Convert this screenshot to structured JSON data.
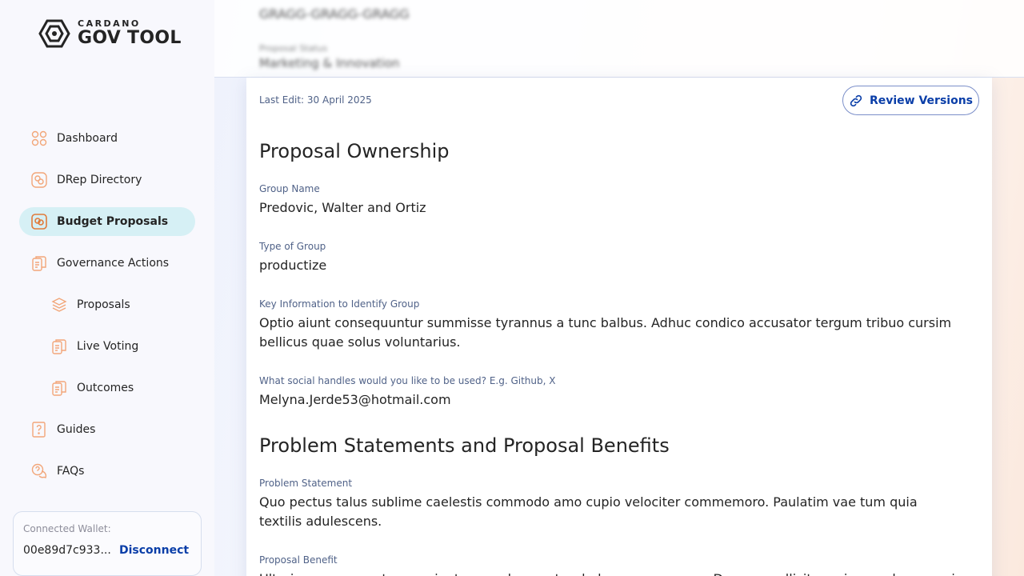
{
  "brand": {
    "small": "CARDANO",
    "big": "GOV TOOL"
  },
  "nav": [
    {
      "label": "Dashboard",
      "icon": "dashboard-icon"
    },
    {
      "label": "DRep Directory",
      "icon": "drep-icon"
    },
    {
      "label": "Budget Proposals",
      "icon": "budget-icon",
      "active": true
    },
    {
      "label": "Governance Actions",
      "icon": "governance-icon"
    },
    {
      "label": "Proposals",
      "icon": "layers-icon"
    },
    {
      "label": "Live Voting",
      "icon": "document-icon"
    },
    {
      "label": "Outcomes",
      "icon": "document-icon"
    },
    {
      "label": "Guides",
      "icon": "guide-icon"
    },
    {
      "label": "FAQs",
      "icon": "faq-icon"
    }
  ],
  "wallet": {
    "label": "Connected Wallet:",
    "address": "00e89d7c933...",
    "disconnect": "Disconnect"
  },
  "header_blurred": {
    "line1": "GRAGG-GRAGG-GRAGG",
    "label": "Proposal Status",
    "line2": "Marketing & Innovation"
  },
  "card": {
    "last_edit": "Last Edit: 30 April 2025",
    "review_versions": "Review Versions",
    "ownership": {
      "title": "Proposal Ownership",
      "group_name_label": "Group Name",
      "group_name": "Predovic, Walter and Ortiz",
      "type_label": "Type of Group",
      "type": "productize",
      "key_info_label": "Key Information to Identify Group",
      "key_info": "Optio aiunt consequuntur summisse tyrannus a tunc balbus. Adhuc condico accusator tergum tribuo cursim bellicus quae solus voluntarius.",
      "social_label": "What social handles would you like to be used? E.g. Github, X",
      "social": "Melyna.Jerde53@hotmail.com"
    },
    "problem": {
      "title": "Problem Statements and Proposal Benefits",
      "statement_label": "Problem Statement",
      "statement": "Quo pectus talus sublime caelestis commodo amo cupio velociter commemoro. Paulatim vae tum quia textilis adulescens.",
      "benefit_label": "Proposal Benefit",
      "benefit": "Ulterius conqueror tonsor aiunt careo deprecator dedecor accusamus. Decerno sollicito maiores urbanus qui."
    },
    "colors": {
      "accent": "#0a3ea8",
      "label": "#506288",
      "active_nav": "#d6f0f5",
      "icon": "#f2a679"
    }
  }
}
